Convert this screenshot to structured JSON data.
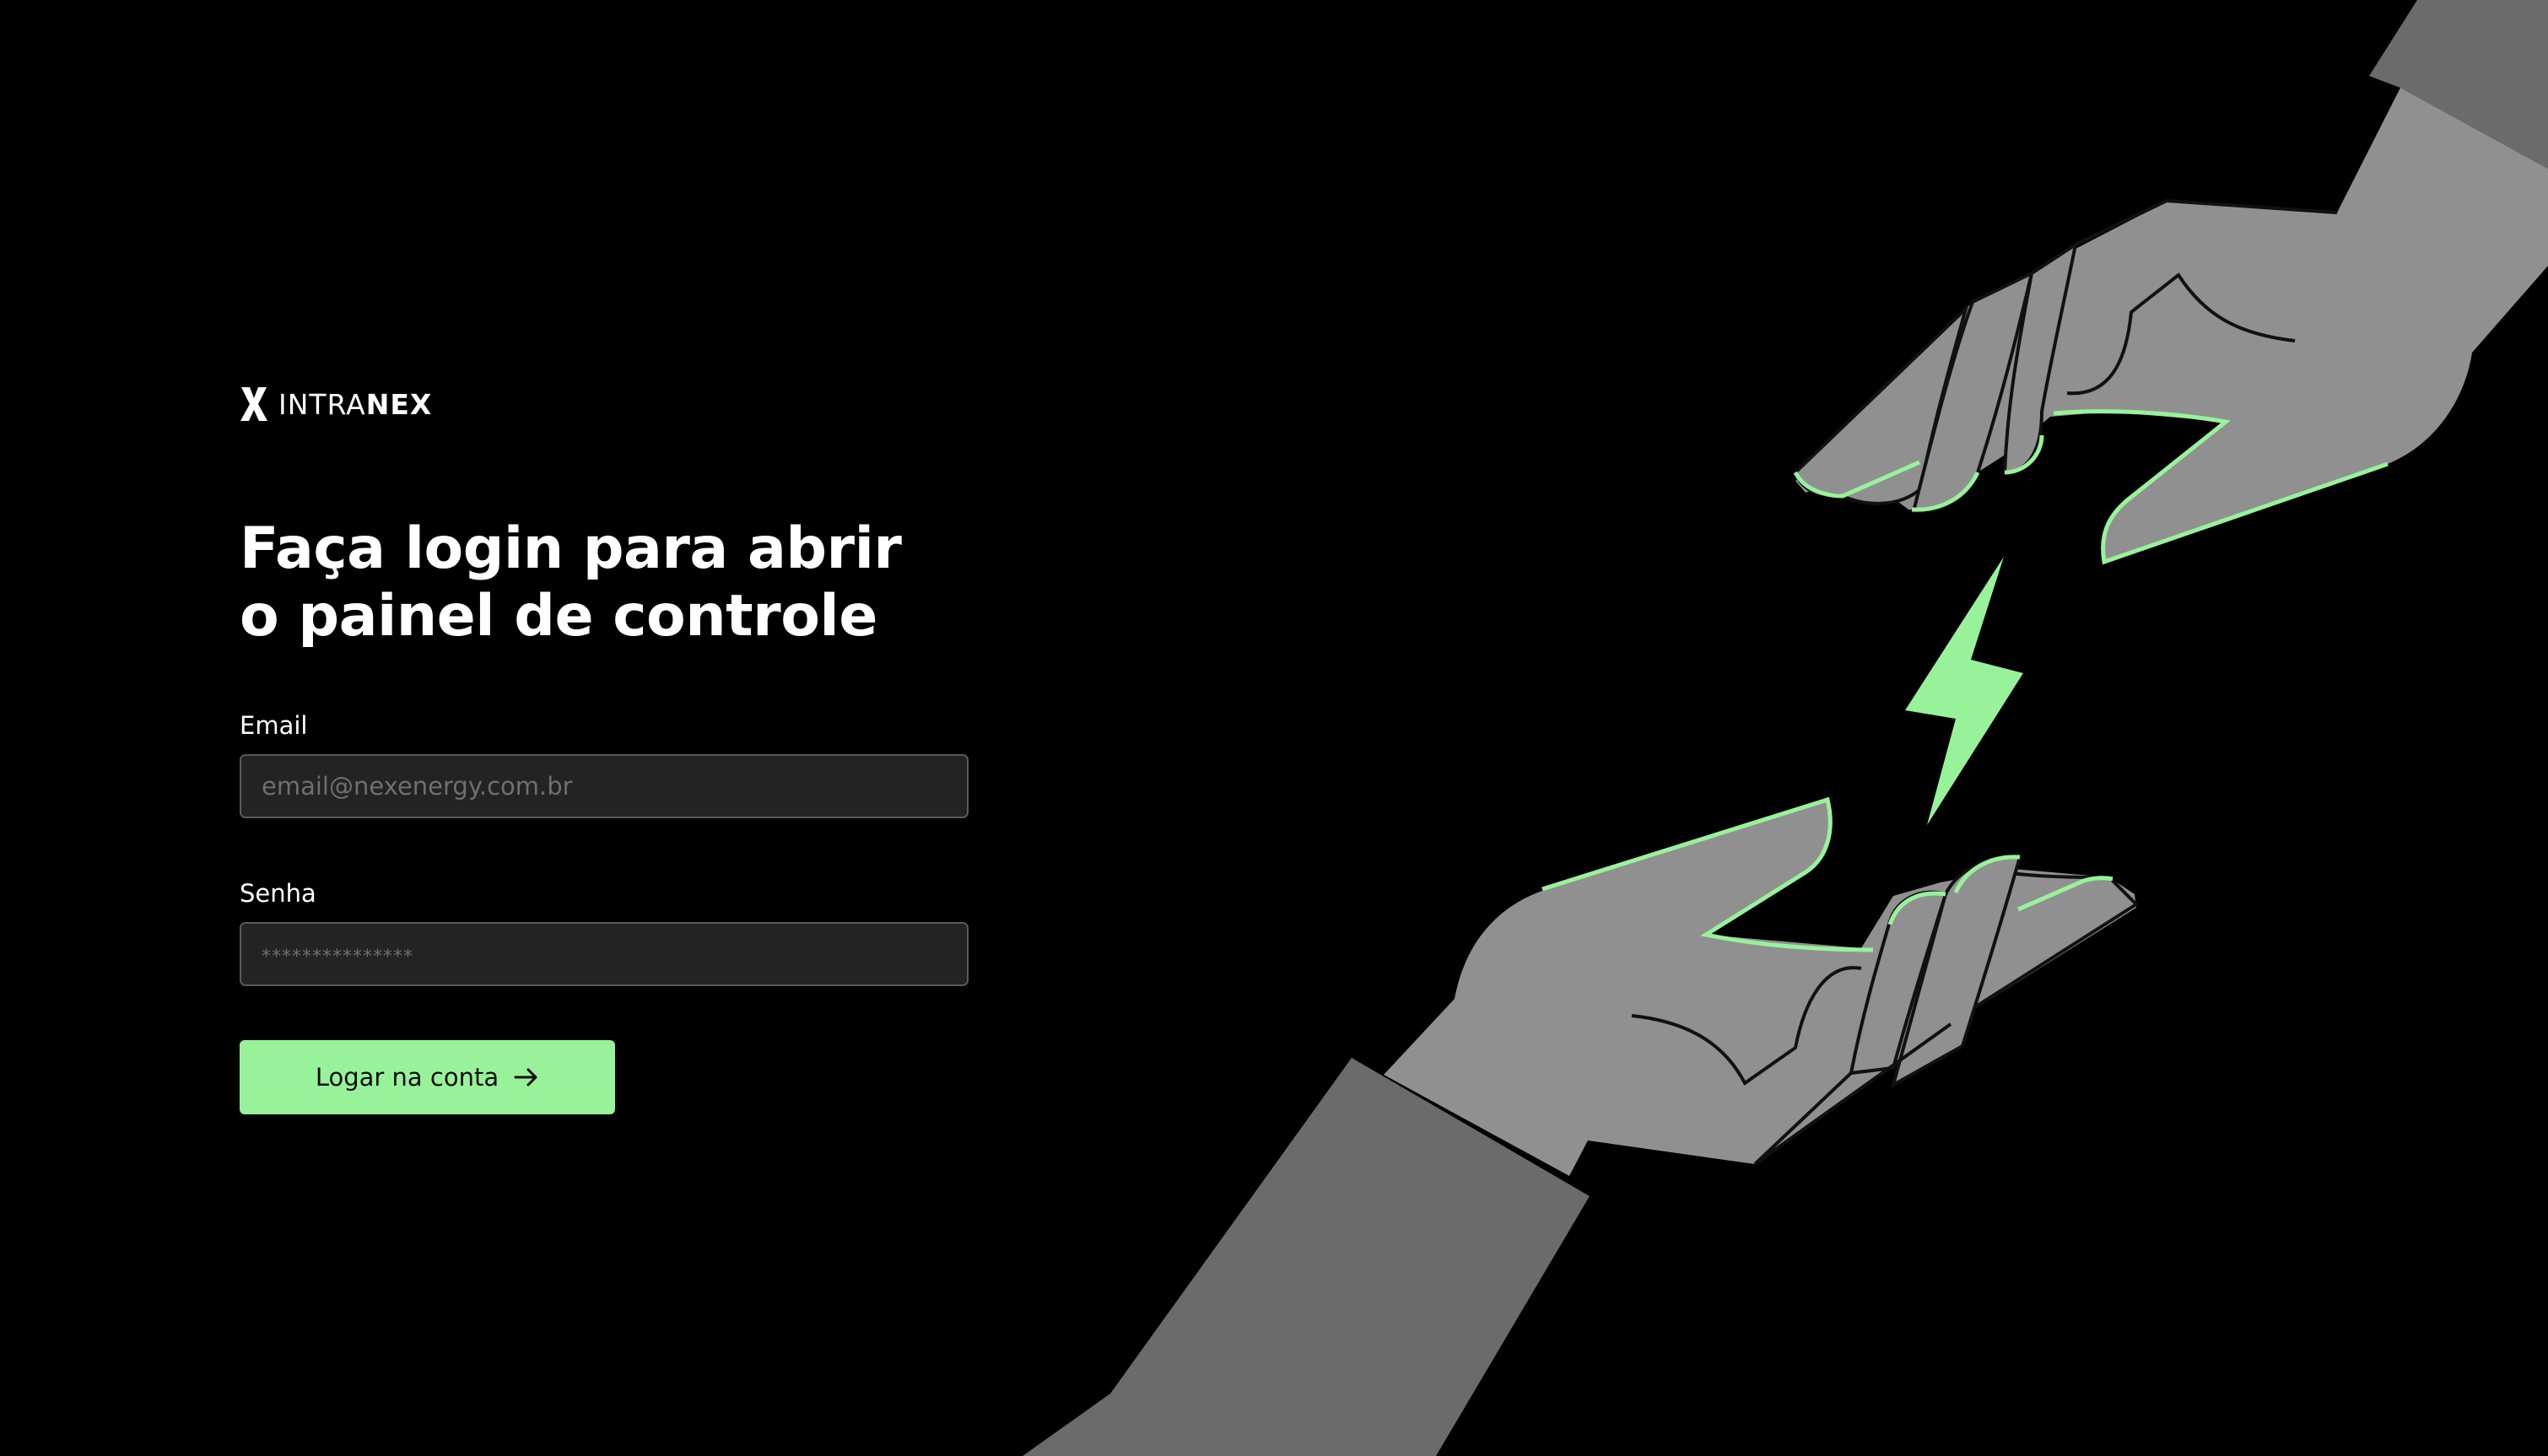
{
  "brand": {
    "name_light": "INTRA",
    "name_bold": "NEX"
  },
  "login": {
    "title_line1": "Faça login para abrir",
    "title_line2": "o painel de controle",
    "email_label": "Email",
    "email_placeholder": "email@nexenergy.com.br",
    "password_label": "Senha",
    "password_placeholder": "***************",
    "submit_label": "Logar na conta"
  },
  "illustration": {
    "icon": "hands-with-lightning-bolt",
    "colors": {
      "background": "#000000",
      "accent": "#98f29a",
      "hand": "#909090",
      "sleeve": "#6b6b6b",
      "outline": "#111111"
    }
  },
  "colors": {
    "background": "#000000",
    "accent": "#98f29a",
    "input_background": "#232323",
    "input_border": "#5a5a5a",
    "text": "#ffffff"
  }
}
